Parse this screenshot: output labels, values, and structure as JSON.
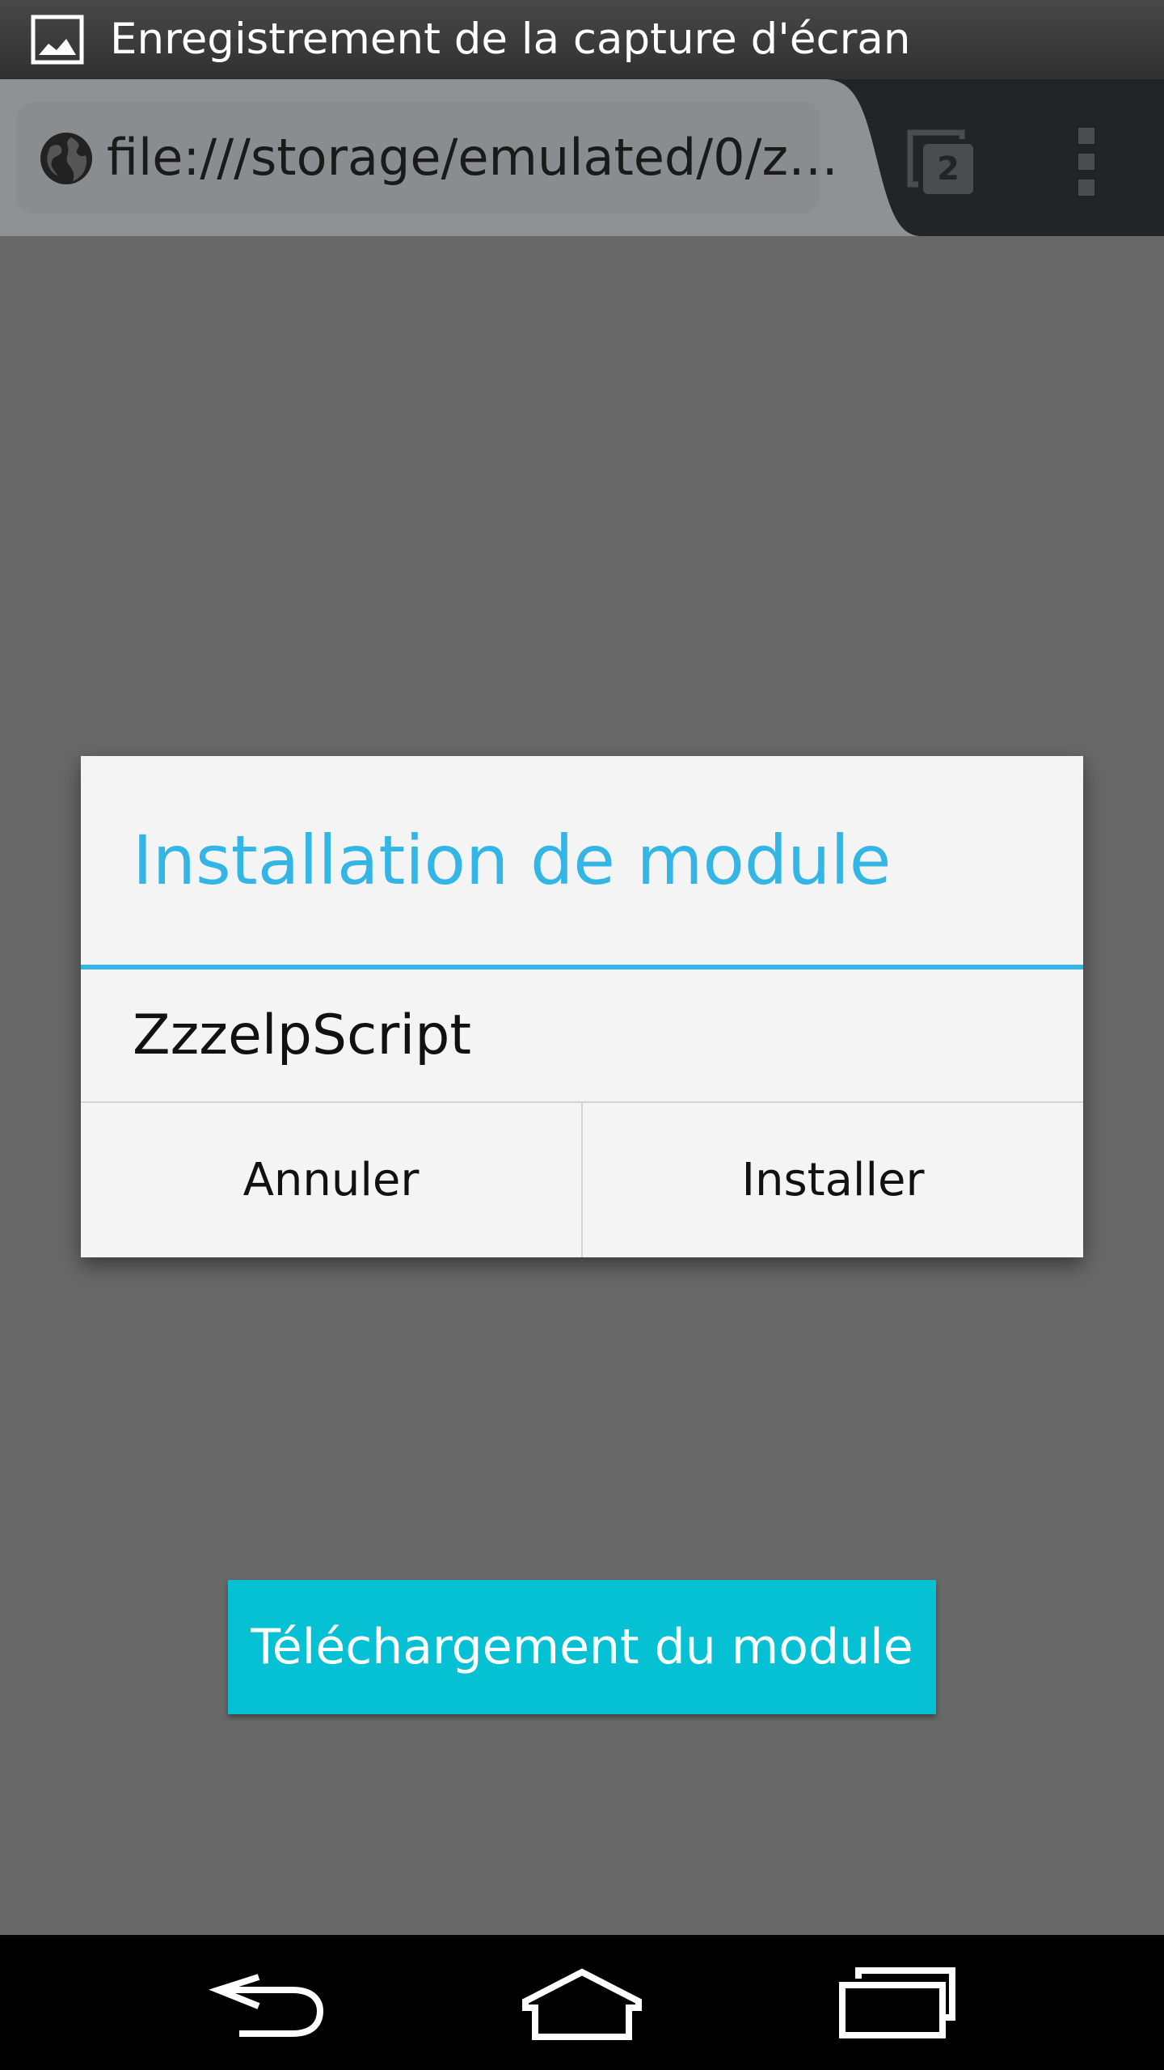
{
  "status_bar": {
    "notification_icon": "image-icon",
    "text": "Enregistrement de la capture d'écran"
  },
  "toolbar": {
    "url_icon": "globe-icon",
    "url": "file:///storage/emulated/0/z…",
    "tab_count": "2",
    "menu_icon": "overflow-menu-icon"
  },
  "dialog": {
    "title": "Installation de module",
    "message": "ZzzelpScript",
    "cancel_label": "Annuler",
    "install_label": "Installer"
  },
  "page": {
    "download_button_label": "Téléchargement du module"
  },
  "nav_bar": {
    "back_icon": "back-icon",
    "home_icon": "home-icon",
    "recents_icon": "recent-apps-icon"
  },
  "colors": {
    "accent": "#33b5e5",
    "button": "#06c0d3",
    "scrim": "#686868"
  }
}
